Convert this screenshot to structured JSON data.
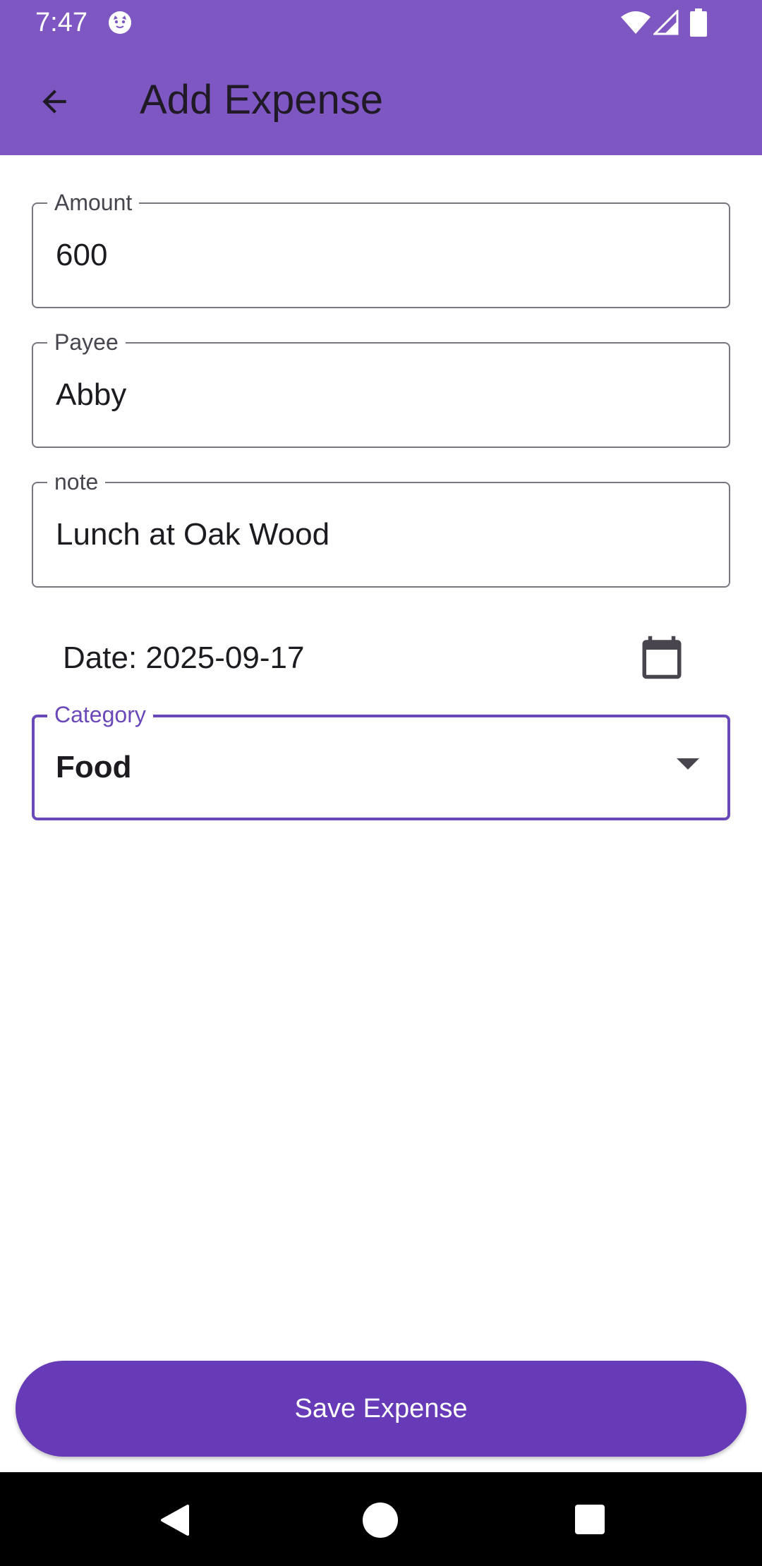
{
  "status_bar": {
    "time": "7:47",
    "app_icon": "cat-face-icon",
    "wifi_icon": "wifi-icon",
    "signal_icon": "cell-signal-icon",
    "battery_icon": "battery-icon"
  },
  "app_bar": {
    "back_icon": "arrow-back-icon",
    "title": "Add Expense"
  },
  "form": {
    "amount": {
      "label": "Amount",
      "value": "600"
    },
    "payee": {
      "label": "Payee",
      "value": "Abby"
    },
    "note": {
      "label": "note",
      "value": "Lunch at Oak Wood"
    },
    "date": {
      "text": "Date: 2025-09-17",
      "icon": "calendar-icon"
    },
    "category": {
      "label": "Category",
      "value": "Food",
      "icon": "dropdown-arrow-icon"
    }
  },
  "save_button": {
    "label": "Save Expense"
  },
  "nav_bar": {
    "back_icon": "nav-back-icon",
    "home_icon": "nav-home-icon",
    "recents_icon": "nav-recents-icon"
  },
  "colors": {
    "app_bar": "#7e57c2",
    "accent": "#673ab7",
    "focus": "#6b48b9",
    "outline": "#79747e"
  }
}
